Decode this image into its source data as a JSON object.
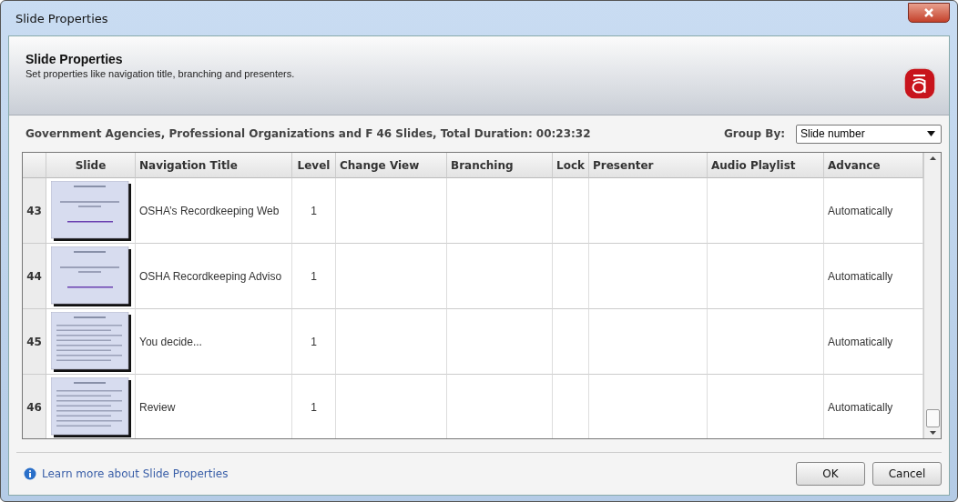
{
  "window": {
    "title": "Slide Properties"
  },
  "header": {
    "title": "Slide Properties",
    "subtitle": "Set properties like navigation title, branching and presenters."
  },
  "info": {
    "course": "Government Agencies, Professional Organizations and F",
    "summary": "46 Slides, Total Duration: 00:23:32",
    "group_by_label": "Group By:",
    "group_by_value": "Slide number"
  },
  "table": {
    "columns": [
      "Slide",
      "Navigation Title",
      "Level",
      "Change View",
      "Branching",
      "Lock",
      "Presenter",
      "Audio Playlist",
      "Advance"
    ],
    "rows": [
      {
        "number": "43",
        "navigation_title": "OSHA’s Recordkeeping Web",
        "level_text": "1",
        "advance": "Automatically"
      },
      {
        "number": "44",
        "navigation_title": "OSHA Recordkeeping Adviso",
        "level_text": "1",
        "advance": "Automatically"
      },
      {
        "number": "45",
        "navigation_title": "You decide...",
        "level_text": "1",
        "advance": "Automatically"
      },
      {
        "number": "46",
        "navigation_title": "Review",
        "level_text": "1",
        "advance": "Automatically"
      }
    ]
  },
  "footer": {
    "link": "Learn more about Slide Properties",
    "buttons": [
      "OK",
      "Cancel"
    ]
  }
}
